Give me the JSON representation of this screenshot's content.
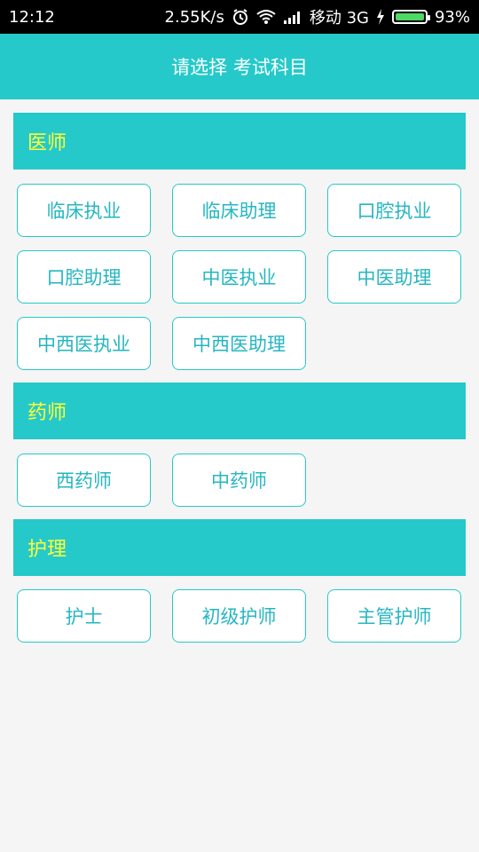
{
  "status_bar": {
    "time": "12:12",
    "speed": "2.55K/s",
    "carrier": "移动 3G",
    "battery": "93%",
    "icons": [
      "alarm-icon",
      "wifi-icon",
      "signal-icon",
      "charging-icon",
      "battery-icon"
    ]
  },
  "header": {
    "title": "请选择 考试科目"
  },
  "sections": [
    {
      "title": "医师",
      "items": [
        "临床执业",
        "临床助理",
        "口腔执业",
        "口腔助理",
        "中医执业",
        "中医助理",
        "中西医执业",
        "中西医助理"
      ]
    },
    {
      "title": "药师",
      "items": [
        "西药师",
        "中药师"
      ]
    },
    {
      "title": "护理",
      "items": [
        "护士",
        "初级护师",
        "主管护师"
      ]
    }
  ],
  "colors": {
    "accent": "#26c9c9",
    "section_title": "#ffff33",
    "chip_text": "#26b6c1",
    "background": "#f5f5f5"
  }
}
